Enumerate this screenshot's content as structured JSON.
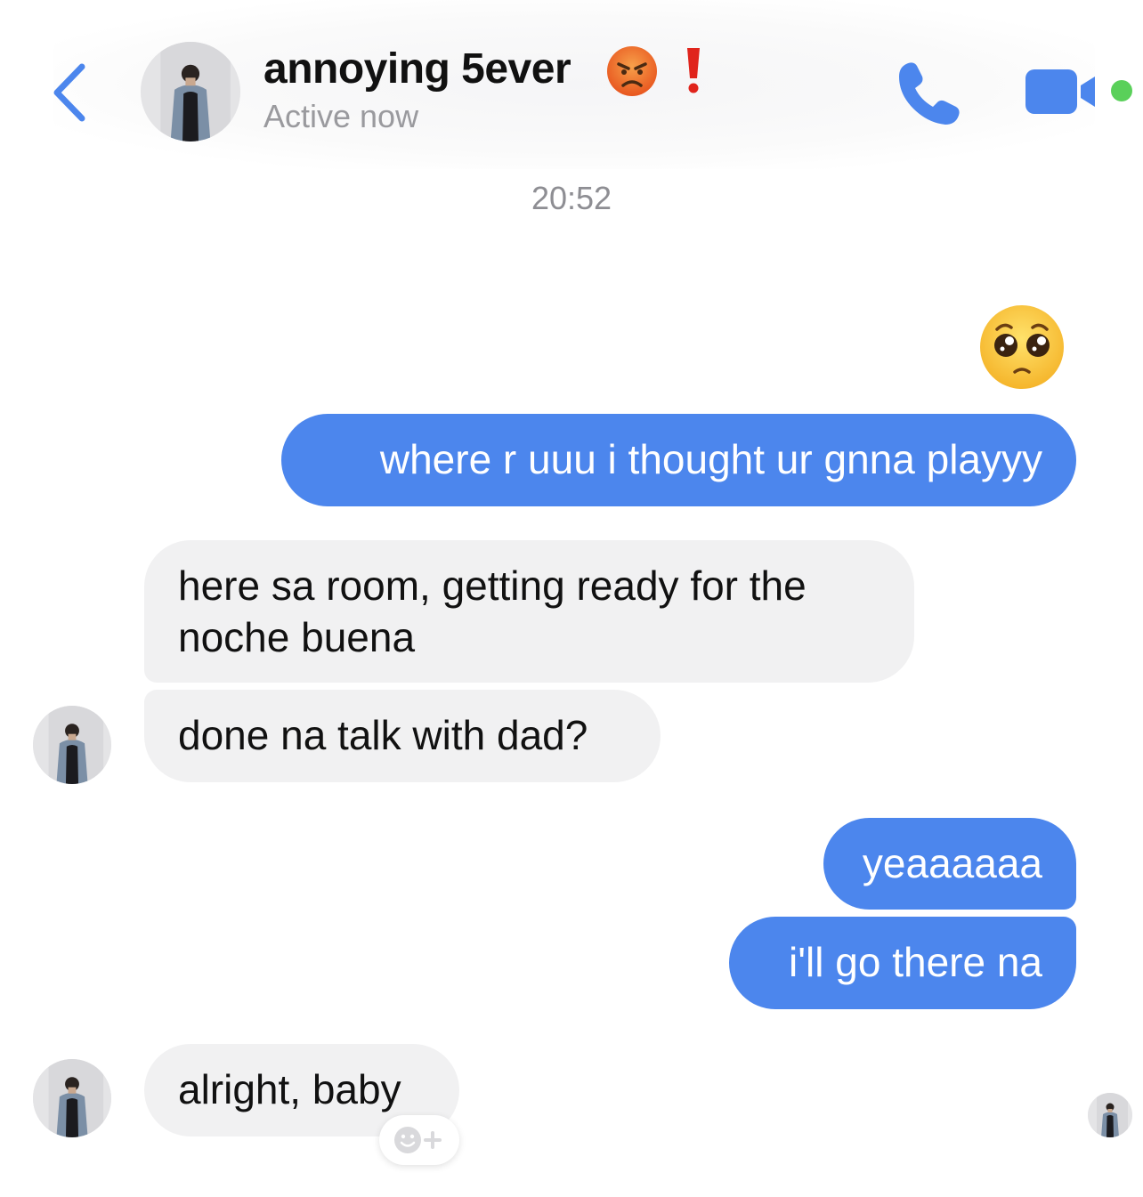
{
  "header": {
    "contact_name": "annoying 5ever",
    "status": "Active now"
  },
  "icons": {
    "back": "chevron-left-icon",
    "call": "phone-icon",
    "video": "video-camera-icon",
    "name_emoji_1": "angry-face-emoji",
    "name_emoji_2": "red-exclamation-emoji",
    "reaction": "add-reaction-icon"
  },
  "colors": {
    "accent": "#4c86ed",
    "incoming_bubble": "#f1f1f2",
    "online": "#5ad05a"
  },
  "conversation": {
    "timestamp": "20:52",
    "messages": [
      {
        "sender": "me",
        "type": "emoji",
        "emoji": "pleading-face-emoji"
      },
      {
        "sender": "me",
        "type": "text",
        "text": "where r uuu i thought ur gnna playyy"
      },
      {
        "sender": "them",
        "type": "text",
        "text": "here sa room, getting ready for the noche buena"
      },
      {
        "sender": "them",
        "type": "text",
        "text": "done na talk with dad?"
      },
      {
        "sender": "me",
        "type": "text",
        "text": "yeaaaaaa"
      },
      {
        "sender": "me",
        "type": "text",
        "text": "i'll go there na"
      },
      {
        "sender": "them",
        "type": "text",
        "text": "alright, baby"
      }
    ]
  }
}
